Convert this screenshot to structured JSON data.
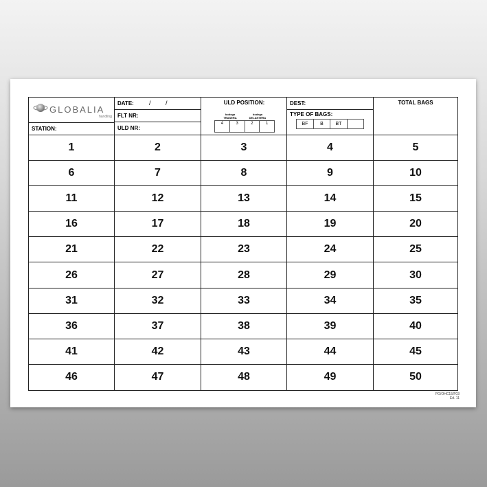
{
  "header": {
    "logo": {
      "name": "GLOBALIA",
      "sub": "handling"
    },
    "station_label": "STATION:",
    "date_label": "DATE:",
    "date_slash_1": "/",
    "date_slash_2": "/",
    "flt_label": "FLT NR:",
    "uld_nr_label": "ULD NR:",
    "uld_position": {
      "title": "ULD POSITION:",
      "bodega_trasera": [
        "bodega",
        "TRASERA"
      ],
      "bodega_delantera": [
        "bodega",
        "DELANTERA"
      ],
      "positions": [
        "4",
        "3",
        "2",
        "1"
      ]
    },
    "dest_label": "DEST:",
    "type_of_bags_label": "TYPE OF BAGS:",
    "bag_types": [
      "BF",
      "B",
      "BT",
      ""
    ],
    "total_bags_label": "TOTAL BAGS"
  },
  "grid_numbers": [
    "1",
    "2",
    "3",
    "4",
    "5",
    "6",
    "7",
    "8",
    "9",
    "10",
    "11",
    "12",
    "13",
    "14",
    "15",
    "16",
    "17",
    "18",
    "19",
    "20",
    "21",
    "22",
    "23",
    "24",
    "25",
    "26",
    "27",
    "28",
    "29",
    "30",
    "31",
    "32",
    "33",
    "34",
    "35",
    "36",
    "37",
    "38",
    "39",
    "40",
    "41",
    "42",
    "43",
    "44",
    "45",
    "46",
    "47",
    "48",
    "49",
    "50"
  ],
  "footer": {
    "code": "PG/OHC15/F03",
    "edition": "Ed. 11"
  }
}
